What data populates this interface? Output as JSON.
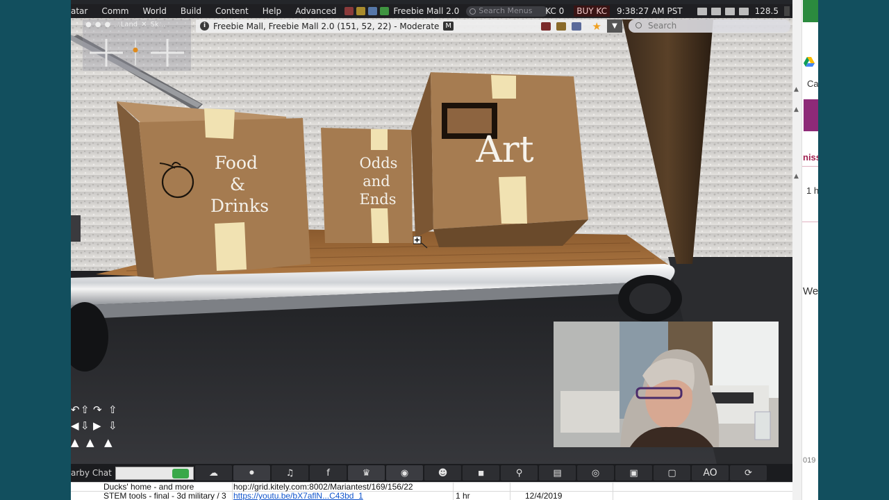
{
  "window": {
    "menus": [
      "atar",
      "Comm",
      "World",
      "Build",
      "Content",
      "Help",
      "Advanced"
    ],
    "region_name": "Freebie Mall 2.0",
    "menu_search_placeholder": "Search Menus",
    "currency": "KC 0",
    "buy_currency": "BUY KC",
    "clock": "9:38:27 AM PST",
    "fps": "128.5"
  },
  "navigation": {
    "location": "Freebie Mall, Freebie Mall 2.0 (151, 52, 22) - Moderate",
    "maturity_badge": "M",
    "search_placeholder": "Search"
  },
  "camera": {
    "labels": [
      "...Land",
      "Sk..."
    ],
    "zoom_plus": "+",
    "zoom_minus": "−"
  },
  "scene": {
    "boxes": [
      {
        "label_lines": [
          "Food",
          "&",
          "Drinks"
        ]
      },
      {
        "label_lines": [
          "Odds",
          "and",
          "Ends"
        ]
      },
      {
        "label_lines": [
          "Art"
        ]
      }
    ],
    "colors": {
      "cardboard": "#a47a4f",
      "tape": "#efdfae",
      "wall": "#dad8d6",
      "floor": "#2a2b2f"
    }
  },
  "chat": {
    "nearby_label": "arby Chat",
    "toolbar_buttons": [
      "speech-bubble-icon",
      "microphone-icon",
      "headphones-icon",
      "facebook-icon",
      "walk-icon",
      "eye-icon",
      "people-icon",
      "shirt-icon",
      "search-icon",
      "map-icon",
      "radar-icon",
      "camera-icon",
      "inventory-icon",
      "AO",
      "spinner-icon"
    ],
    "ao_label": "AO"
  },
  "spreadsheet": {
    "rows": [
      {
        "title": "Ducks' home - and more",
        "link": "hop://grid.kitely.com:8002/Mariantest/169/156/22",
        "duration": "",
        "date": ""
      },
      {
        "title": "STEM tools - final - 3d military / 3",
        "link": "https://youtu.be/bX7aflN...C43bd_1",
        "duration": "1 hr",
        "date": "12/4/2019"
      }
    ]
  },
  "background_browser": {
    "fragments": [
      "Ca",
      "niss",
      "1 h",
      "We",
      "019"
    ]
  }
}
